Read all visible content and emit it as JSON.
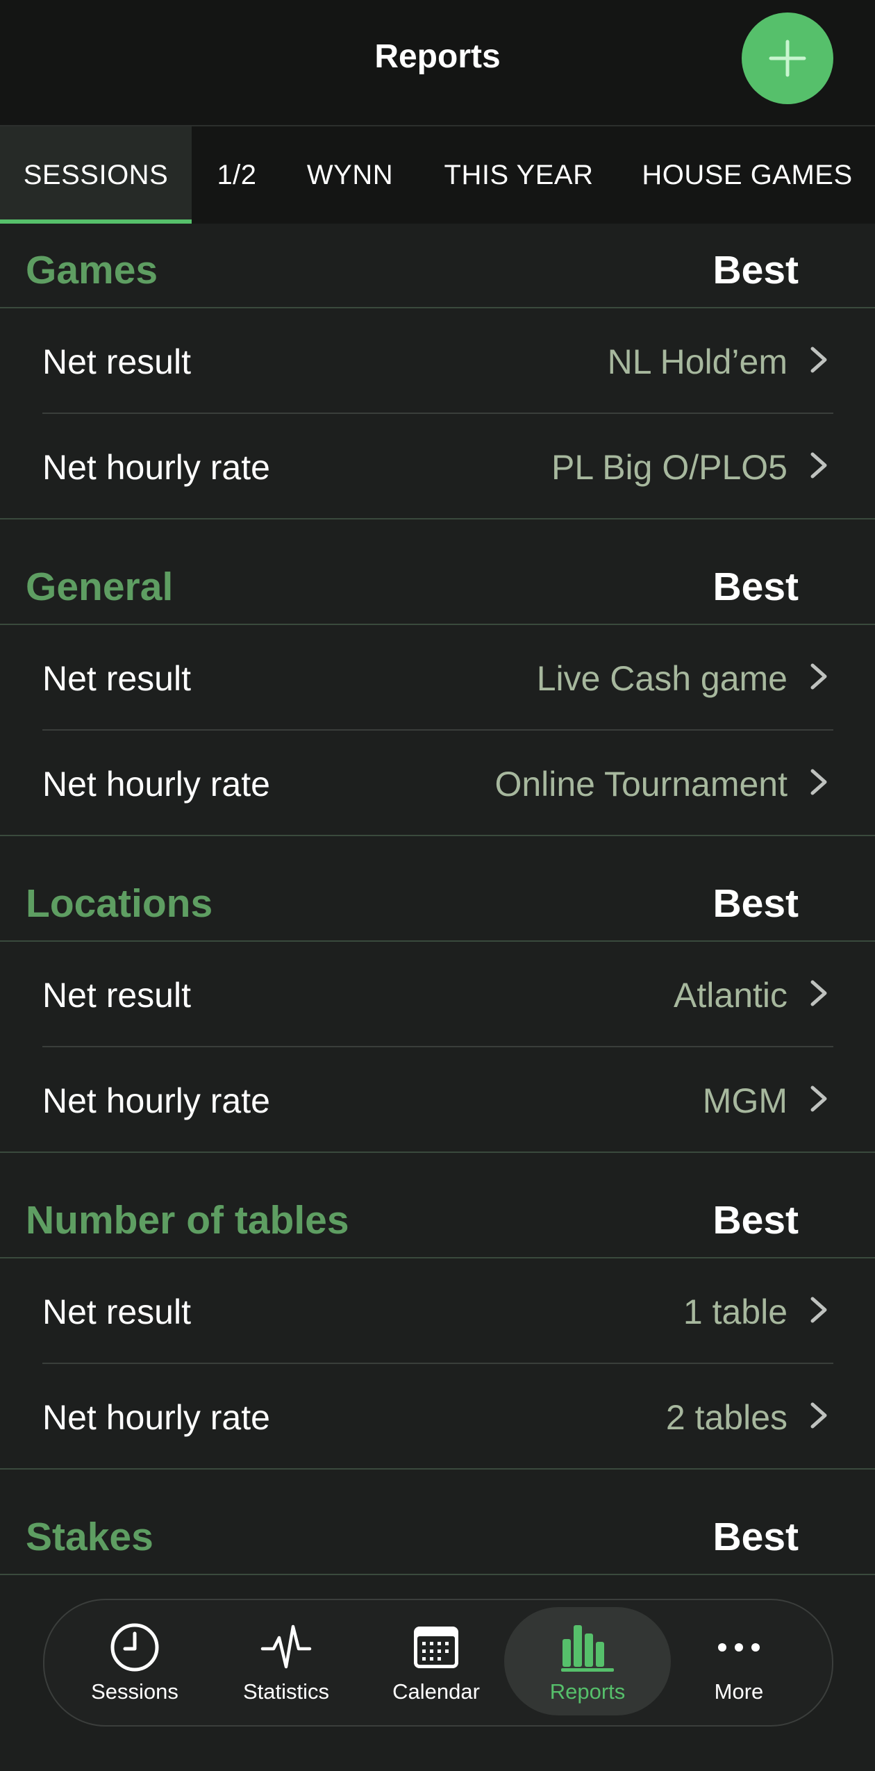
{
  "header": {
    "title": "Reports"
  },
  "tabs": [
    {
      "label": "SESSIONS",
      "active": true
    },
    {
      "label": "1/2"
    },
    {
      "label": "WYNN"
    },
    {
      "label": "THIS YEAR"
    },
    {
      "label": "HOUSE GAMES"
    }
  ],
  "sections": [
    {
      "title": "Games",
      "best_label": "Best",
      "rows": [
        {
          "label": "Net result",
          "value": "NL Hold’em"
        },
        {
          "label": "Net hourly rate",
          "value": "PL Big O/PLO5"
        }
      ]
    },
    {
      "title": "General",
      "best_label": "Best",
      "rows": [
        {
          "label": "Net result",
          "value": "Live Cash game"
        },
        {
          "label": "Net hourly rate",
          "value": "Online Tournament"
        }
      ]
    },
    {
      "title": "Locations",
      "best_label": "Best",
      "rows": [
        {
          "label": "Net result",
          "value": "Atlantic"
        },
        {
          "label": "Net hourly rate",
          "value": "MGM"
        }
      ]
    },
    {
      "title": "Number of tables",
      "best_label": "Best",
      "rows": [
        {
          "label": "Net result",
          "value": "1 table"
        },
        {
          "label": "Net hourly rate",
          "value": "2 tables"
        }
      ]
    },
    {
      "title": "Stakes",
      "best_label": "Best",
      "rows": []
    }
  ],
  "bottom_nav": [
    {
      "label": "Sessions",
      "icon": "clock-icon"
    },
    {
      "label": "Statistics",
      "icon": "pulse-icon"
    },
    {
      "label": "Calendar",
      "icon": "calendar-icon"
    },
    {
      "label": "Reports",
      "icon": "bar-chart-icon",
      "active": true
    },
    {
      "label": "More",
      "icon": "ellipsis-icon"
    }
  ],
  "colors": {
    "accent": "#56c06b",
    "section_title": "#5e9e62",
    "value_text": "#a7b89e",
    "background": "#1d1f1e"
  }
}
